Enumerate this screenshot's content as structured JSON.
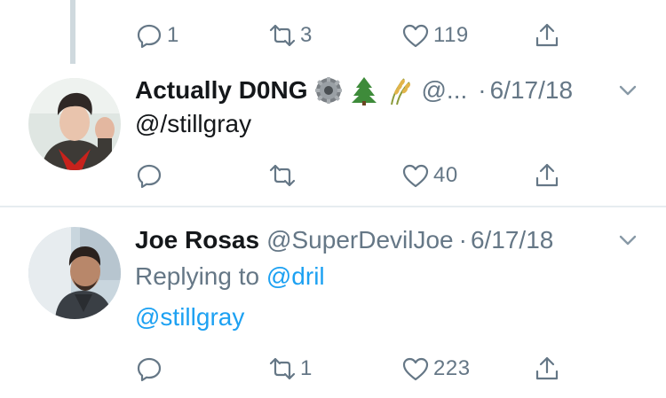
{
  "top_actions": {
    "reply_count": "1",
    "retweet_count": "3",
    "like_count": "119"
  },
  "tweet1": {
    "display_name": "Actually D0NG",
    "handle": "@...",
    "separator": "·",
    "date": "6/17/18",
    "text": "@/stillgray",
    "reply_count": "",
    "retweet_count": "",
    "like_count": "40",
    "emojis": [
      "gear-emoji",
      "evergreen-tree-emoji",
      "rice-sheaf-emoji"
    ]
  },
  "tweet2": {
    "display_name": "Joe Rosas",
    "handle": "@SuperDevilJoe",
    "separator": "·",
    "date": "6/17/18",
    "replying_prefix": "Replying to",
    "replying_to": "@dril",
    "text": "@stillgray",
    "reply_count": "",
    "retweet_count": "1",
    "like_count": "223"
  },
  "colors": {
    "text_primary": "#14171a",
    "text_secondary": "#657786",
    "link": "#1da1f2",
    "divider": "#e6ecf0",
    "thread_line": "#cfd9de"
  }
}
